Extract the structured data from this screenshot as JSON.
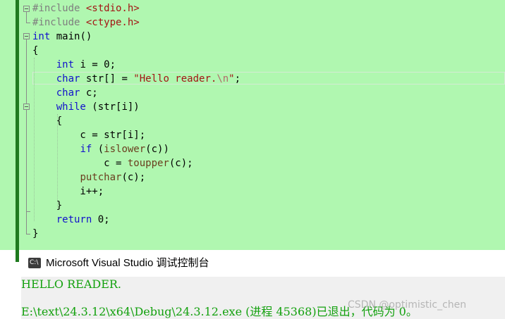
{
  "editor": {
    "code_lines": [
      [
        {
          "t": "#include ",
          "c": "pp"
        },
        {
          "t": "<stdio.h>",
          "c": "str"
        }
      ],
      [
        {
          "t": "#include ",
          "c": "pp"
        },
        {
          "t": "<ctype.h>",
          "c": "str"
        }
      ],
      [
        {
          "t": "int",
          "c": "kw"
        },
        {
          "t": " main()",
          "c": ""
        }
      ],
      [
        {
          "t": "{",
          "c": ""
        }
      ],
      [
        {
          "t": "    ",
          "c": ""
        },
        {
          "t": "int",
          "c": "kw"
        },
        {
          "t": " i = 0;",
          "c": ""
        }
      ],
      [
        {
          "t": "    ",
          "c": ""
        },
        {
          "t": "char",
          "c": "kw"
        },
        {
          "t": " str[] = ",
          "c": ""
        },
        {
          "t": "\"Hello reader.",
          "c": "str"
        },
        {
          "t": "\\n",
          "c": "esc"
        },
        {
          "t": "\"",
          "c": "str"
        },
        {
          "t": ";",
          "c": ""
        }
      ],
      [
        {
          "t": "    ",
          "c": ""
        },
        {
          "t": "char",
          "c": "kw"
        },
        {
          "t": " c;",
          "c": ""
        }
      ],
      [
        {
          "t": "    ",
          "c": ""
        },
        {
          "t": "while",
          "c": "kw"
        },
        {
          "t": " (str[i])",
          "c": ""
        }
      ],
      [
        {
          "t": "    {",
          "c": ""
        }
      ],
      [
        {
          "t": "        c = str[i];",
          "c": ""
        }
      ],
      [
        {
          "t": "        ",
          "c": ""
        },
        {
          "t": "if",
          "c": "kw"
        },
        {
          "t": " (",
          "c": ""
        },
        {
          "t": "islower",
          "c": "fn"
        },
        {
          "t": "(c))",
          "c": ""
        }
      ],
      [
        {
          "t": "            c = ",
          "c": ""
        },
        {
          "t": "toupper",
          "c": "fn"
        },
        {
          "t": "(c);",
          "c": ""
        }
      ],
      [
        {
          "t": "        ",
          "c": ""
        },
        {
          "t": "putchar",
          "c": "fn"
        },
        {
          "t": "(c);",
          "c": ""
        }
      ],
      [
        {
          "t": "        i++;",
          "c": ""
        }
      ],
      [
        {
          "t": "    }",
          "c": ""
        }
      ],
      [
        {
          "t": "    ",
          "c": ""
        },
        {
          "t": "return",
          "c": "kw"
        },
        {
          "t": " 0;",
          "c": ""
        }
      ],
      [
        {
          "t": "}",
          "c": ""
        }
      ]
    ]
  },
  "console": {
    "title": "Microsoft Visual Studio 调试控制台",
    "icon": "visual-studio-icon",
    "output_lines": [
      "HELLO READER.",
      "E:\\text\\24.3.12\\x64\\Debug\\24.3.12.exe (进程 45368)已退出，代码为 0。"
    ]
  },
  "watermark": "CSDN @optimistic_chen",
  "colors": {
    "editor_bg": "#b0f7b0",
    "keyword": "#1111cc",
    "string": "#a31515",
    "console_text": "#13a10e"
  }
}
